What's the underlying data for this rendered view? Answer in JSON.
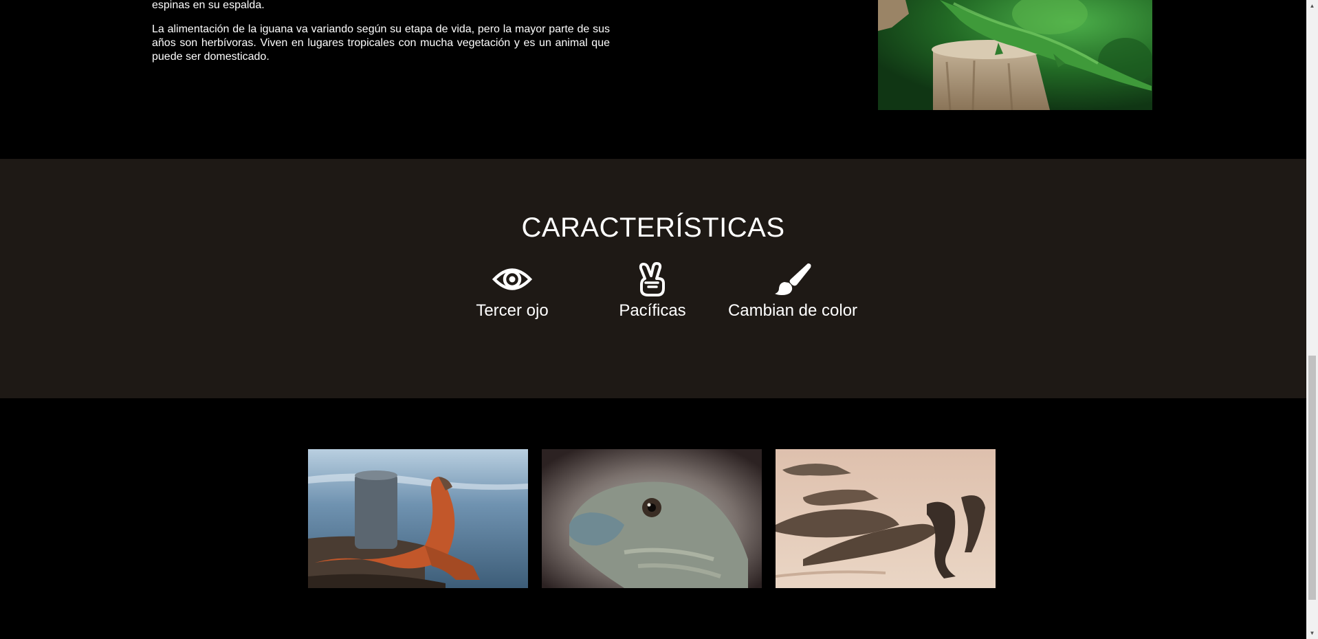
{
  "about": {
    "paragraphs": [
      "una coloración con tonos verdes y al ir madurando predomina un color grisáceo con crestas o espinas en su espalda.",
      "La alimentación de la iguana va variando según su etapa de vida, pero la mayor parte de sus años son herbívoras. Viven en lugares tropicales con mucha vegetación y es un animal que puede ser domesticado."
    ],
    "image": "green iguana on a tree stump"
  },
  "features": {
    "title": "CARACTERÍSTICAS",
    "items": [
      {
        "label": "Tercer ojo",
        "icon": "eye-icon"
      },
      {
        "label": "Pacíficas",
        "icon": "peace-hand-icon"
      },
      {
        "label": "Cambian de color",
        "icon": "paint-brush-icon"
      }
    ]
  },
  "gallery": {
    "images": [
      "iguana by the sea",
      "close-up of an iguana head",
      "group of iguanas on sand"
    ]
  },
  "colors": {
    "page_background": "#000000",
    "features_background": "#1e1915",
    "text": "#ffffff"
  }
}
